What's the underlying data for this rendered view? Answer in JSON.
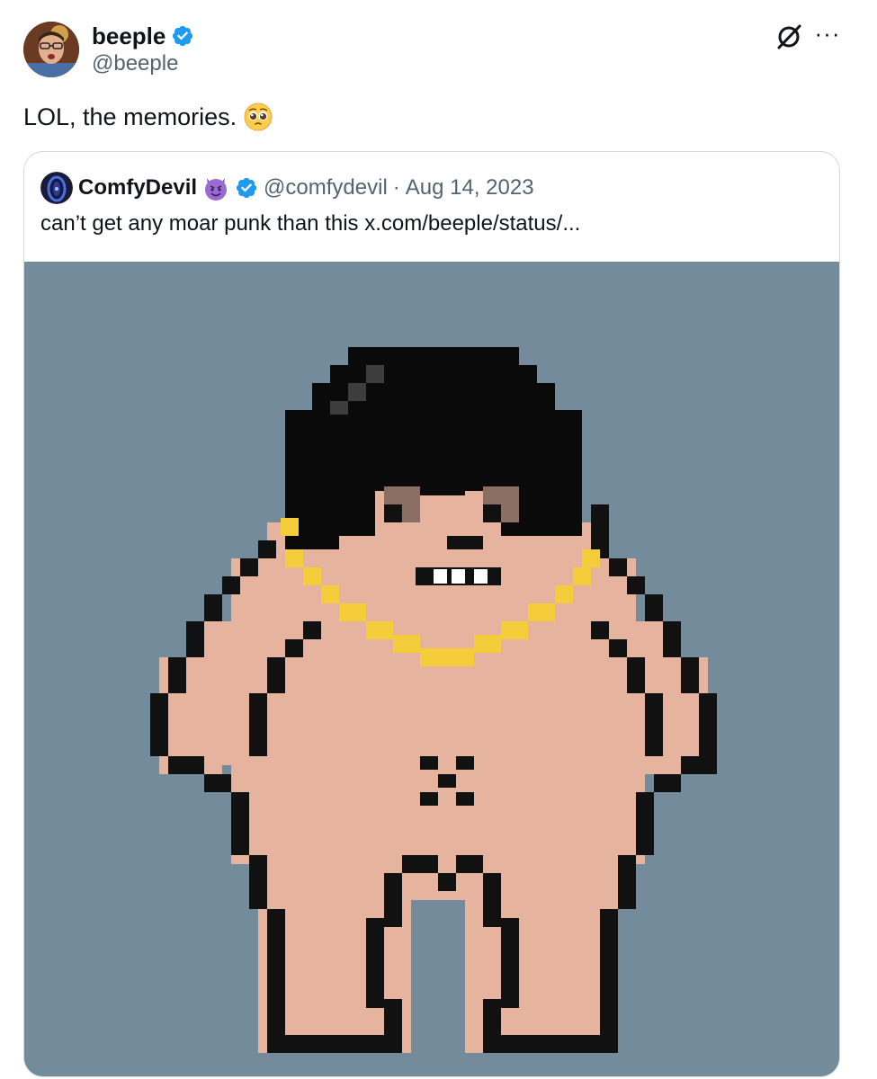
{
  "tweet": {
    "author": {
      "name": "beeple",
      "handle": "@beeple",
      "verified": true,
      "avatar_icon": "avatar-photo"
    },
    "text": "LOL, the memories.",
    "emoji": "pleading-face-emoji",
    "actions": {
      "grok_icon": "grok-icon",
      "more_icon": "more-options-icon",
      "more_label": "···"
    },
    "quote": {
      "name": "ComfyDevil",
      "name_emoji": "smiling-devil-emoji",
      "handle": "@comfydevil",
      "separator": "·",
      "date": "Aug 14, 2023",
      "text": "can’t get any moar punk than this  x.com/beeple/status/...",
      "image": {
        "description_icon": "pixel-punk-character",
        "background": "#748b9c"
      }
    }
  },
  "colors": {
    "verified_blue": "#1d9bf0",
    "muted_text": "#536471",
    "border": "#cfd9de",
    "skin": "#e6b39f",
    "hair": "#0a0a0a",
    "chain": "#f5cd3b"
  }
}
